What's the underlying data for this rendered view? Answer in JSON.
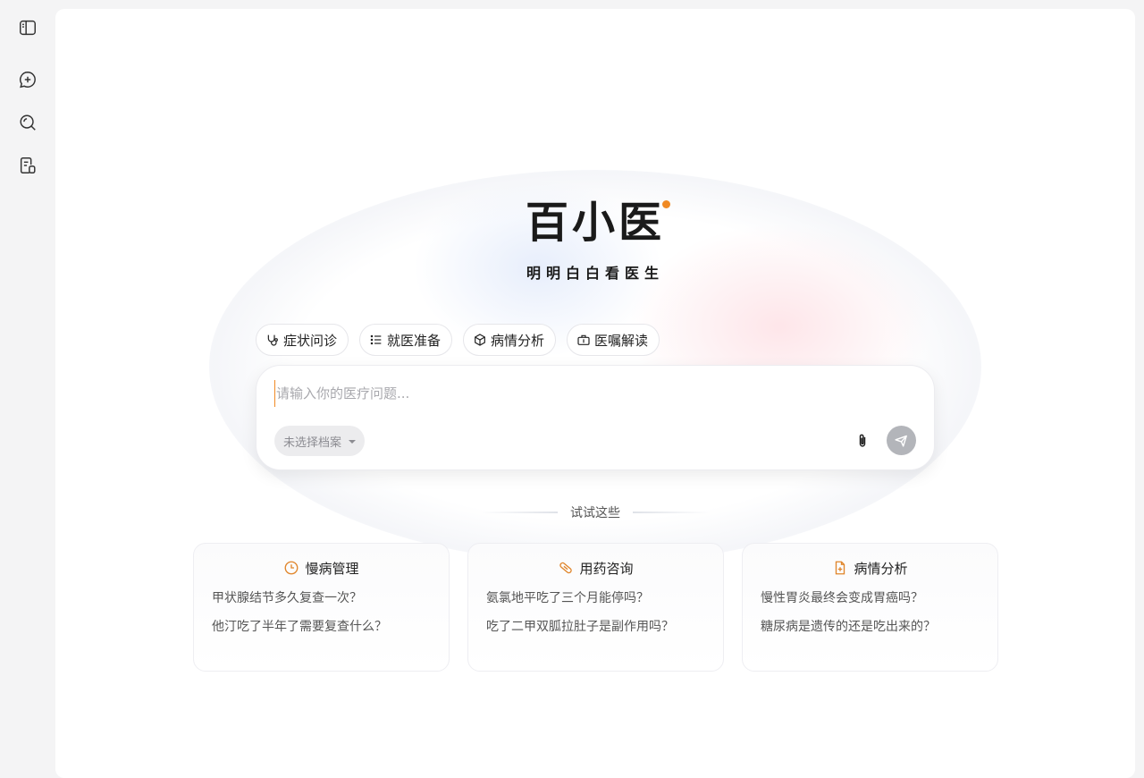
{
  "app": {
    "brand_name": "百小医",
    "slogan": "明明白白看医生"
  },
  "sidebar": {
    "items": [
      {
        "icon": "sidebar-toggle-icon"
      },
      {
        "icon": "new-chat-icon"
      },
      {
        "icon": "search-icon"
      },
      {
        "icon": "records-icon"
      }
    ]
  },
  "modes": [
    {
      "label": "症状问诊",
      "icon": "stethoscope-icon"
    },
    {
      "label": "就医准备",
      "icon": "checklist-icon"
    },
    {
      "label": "病情分析",
      "icon": "cube-icon"
    },
    {
      "label": "医嘱解读",
      "icon": "medkit-icon"
    }
  ],
  "composer": {
    "placeholder": "请输入你的医疗问题...",
    "profile_select": "未选择档案"
  },
  "suggestions": {
    "heading": "试试这些",
    "cards": [
      {
        "title": "慢病管理",
        "icon": "clock-icon",
        "questions": [
          "甲状腺结节多久复查一次？",
          "他汀吃了半年了需要复查什么？"
        ]
      },
      {
        "title": "用药咨询",
        "icon": "pill-icon",
        "questions": [
          "氨氯地平吃了三个月能停吗？",
          "吃了二甲双胍拉肚子是副作用吗？"
        ]
      },
      {
        "title": "病情分析",
        "icon": "report-icon",
        "questions": [
          "慢性胃炎最终会变成胃癌吗？",
          "糖尿病是遗传的还是吃出来的？"
        ]
      }
    ]
  },
  "colors": {
    "accent": "#f08a24",
    "send_disabled": "#b3b5ba",
    "page_bg": "#f4f4f5"
  }
}
